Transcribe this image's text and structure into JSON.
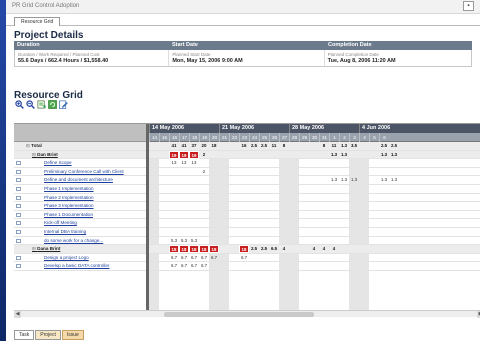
{
  "window": {
    "title": "PR Grid Control Adoption",
    "button": "▪"
  },
  "tabs": {
    "main": "Resource Grid"
  },
  "project_details": {
    "title": "Project Details",
    "headers": [
      "Duration",
      "Start Date",
      "Completion Date"
    ],
    "duration_label": "Duration / Work Required / Planned Cost",
    "duration_value": "55.6 Days / 662.4 Hours / $1,558.40",
    "start_label": "Planned Start Date",
    "start_value": "Mon, May 15, 2006 9:00 AM",
    "completion_label": "Planned Completion Date",
    "completion_value": "Tue, Aug 8, 2006 11:20 AM"
  },
  "resource_grid": {
    "title": "Resource Grid",
    "toolbar_icons": [
      "zoom-in-icon",
      "zoom-out-icon",
      "export-icon",
      "refresh-icon",
      "edit-icon"
    ],
    "weeks": [
      "14 May 2006",
      "21 May 2006",
      "28 May 2006",
      "4 Jun 2006"
    ],
    "days": [
      "14",
      "15",
      "16",
      "17",
      "18",
      "19",
      "20",
      "21",
      "22",
      "23",
      "24",
      "25",
      "26",
      "27",
      "28",
      "29",
      "30",
      "31",
      "1",
      "2",
      "3",
      "4",
      "5",
      "6"
    ],
    "rows": [
      {
        "name": "Total",
        "kind": "total",
        "cells": {
          "2": "41",
          "3": "41",
          "4": "37",
          "5": "20",
          "6": "18",
          "9": "16",
          "10": "2.5",
          "11": "2.5",
          "12": "11",
          "13": "8",
          "17": "8",
          "18": "11",
          "19": "1.3",
          "20": "3.5",
          "23": "2.5",
          "24": "2.5"
        }
      },
      {
        "name": "Dan Brint",
        "kind": "person",
        "cells": {
          "2": "!19",
          "3": "!19",
          "4": "!19",
          "5": "2",
          "18": "1.3",
          "19": "1.3",
          "23": "1.3",
          "24": "1.3"
        }
      },
      {
        "name": "Define Scope",
        "kind": "task",
        "cells": {
          "2": "13",
          "3": "13",
          "4": "13"
        }
      },
      {
        "name": "Preliminary Conference Call with Client",
        "kind": "task",
        "cells": {
          "5": "2"
        }
      },
      {
        "name": "Define and document architecture",
        "kind": "task",
        "cells": {
          "18": "1.3",
          "19": "1.3",
          "20": "1.3",
          "23": "1.3",
          "24": "1.3"
        }
      },
      {
        "name": "Phase 1 Implementation",
        "kind": "task",
        "cells": {}
      },
      {
        "name": "Phase 2 Implementation",
        "kind": "task",
        "cells": {}
      },
      {
        "name": "Phase 3 Implementation",
        "kind": "task",
        "cells": {}
      },
      {
        "name": "Phase 1 Documentation",
        "kind": "task",
        "cells": {}
      },
      {
        "name": "Kick-off Meeting",
        "kind": "task",
        "cells": {}
      },
      {
        "name": "Internal DBA training",
        "kind": "task",
        "cells": {}
      },
      {
        "name": "do some work for a change...",
        "kind": "task",
        "cells": {
          "2": "5.3",
          "3": "5.3",
          "4": "5.3"
        }
      },
      {
        "name": "Dana Brint",
        "kind": "person",
        "cells": {
          "2": "!18",
          "3": "!18",
          "4": "!18",
          "5": "!18",
          "6": "!18",
          "9": "!18",
          "10": "2.5",
          "11": "2.5",
          "12": "6.5",
          "13": "4",
          "16": "4",
          "17": "4",
          "18": "4"
        }
      },
      {
        "name": "Design a project Logo",
        "kind": "task",
        "cells": {
          "2": "6.7",
          "3": "6.7",
          "4": "6.7",
          "5": "6.7",
          "6": "6.7",
          "9": "6.7"
        }
      },
      {
        "name": "Develop a basic DATA controller",
        "kind": "task",
        "cells": {
          "2": "6.7",
          "3": "6.7",
          "4": "6.7",
          "5": "6.7"
        }
      }
    ]
  },
  "bottom_tabs": [
    "Task",
    "Project",
    "Issue"
  ],
  "colors": {
    "overallocated": "#c81e1e",
    "header_dark": "#4c5566",
    "link": "#1e3f9e"
  }
}
